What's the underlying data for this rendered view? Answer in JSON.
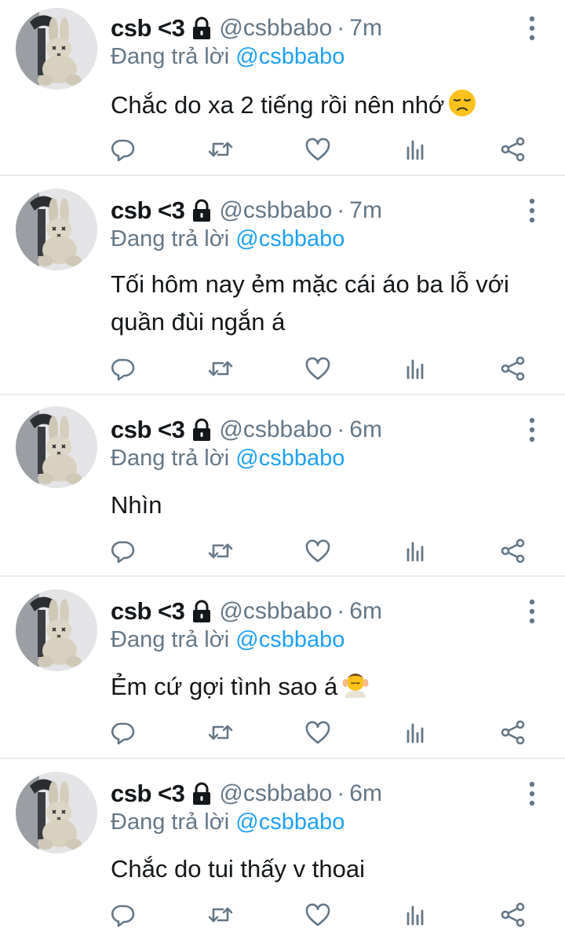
{
  "tweets": [
    {
      "display_name": "csb <3",
      "handle": "@csbbabo",
      "separator": "·",
      "time": "7m",
      "reply_prefix": "Đang trả lời",
      "reply_to": "@csbbabo",
      "text_lines": [
        "Chắc do xa 2 tiếng rồi nên nhớ"
      ],
      "emoji": "disappointed-face-emoji"
    },
    {
      "display_name": "csb <3",
      "handle": "@csbbabo",
      "separator": "·",
      "time": "7m",
      "reply_prefix": "Đang trả lời",
      "reply_to": "@csbbabo",
      "text_lines": [
        "Tối hôm nay ẻm mặc cái áo ba lỗ với",
        "quần đùi ngắn á"
      ],
      "emoji": ""
    },
    {
      "display_name": "csb <3",
      "handle": "@csbbabo",
      "separator": "·",
      "time": "6m",
      "reply_prefix": "Đang trả lời",
      "reply_to": "@csbbabo",
      "text_lines": [
        "Nhìn"
      ],
      "emoji": ""
    },
    {
      "display_name": "csb <3",
      "handle": "@csbbabo",
      "separator": "·",
      "time": "6m",
      "reply_prefix": "Đang trả lời",
      "reply_to": "@csbbabo",
      "text_lines": [
        "Ẻm cứ gợi tình sao á"
      ],
      "emoji": "face-massage-emoji"
    },
    {
      "display_name": "csb <3",
      "handle": "@csbbabo",
      "separator": "·",
      "time": "6m",
      "reply_prefix": "Đang trả lời",
      "reply_to": "@csbbabo",
      "text_lines": [
        "Chắc do tui thấy v thoai"
      ],
      "emoji": ""
    }
  ],
  "icons": {
    "lock": "lock-icon",
    "more": "more-vertical-icon",
    "reply": "reply-icon",
    "retweet": "retweet-icon",
    "like": "heart-icon",
    "analytics": "analytics-icon",
    "share": "share-icon"
  },
  "colors": {
    "text": "#14171a",
    "secondary": "#657786",
    "mention": "#1da1f2",
    "divider": "#e6ecf0"
  }
}
